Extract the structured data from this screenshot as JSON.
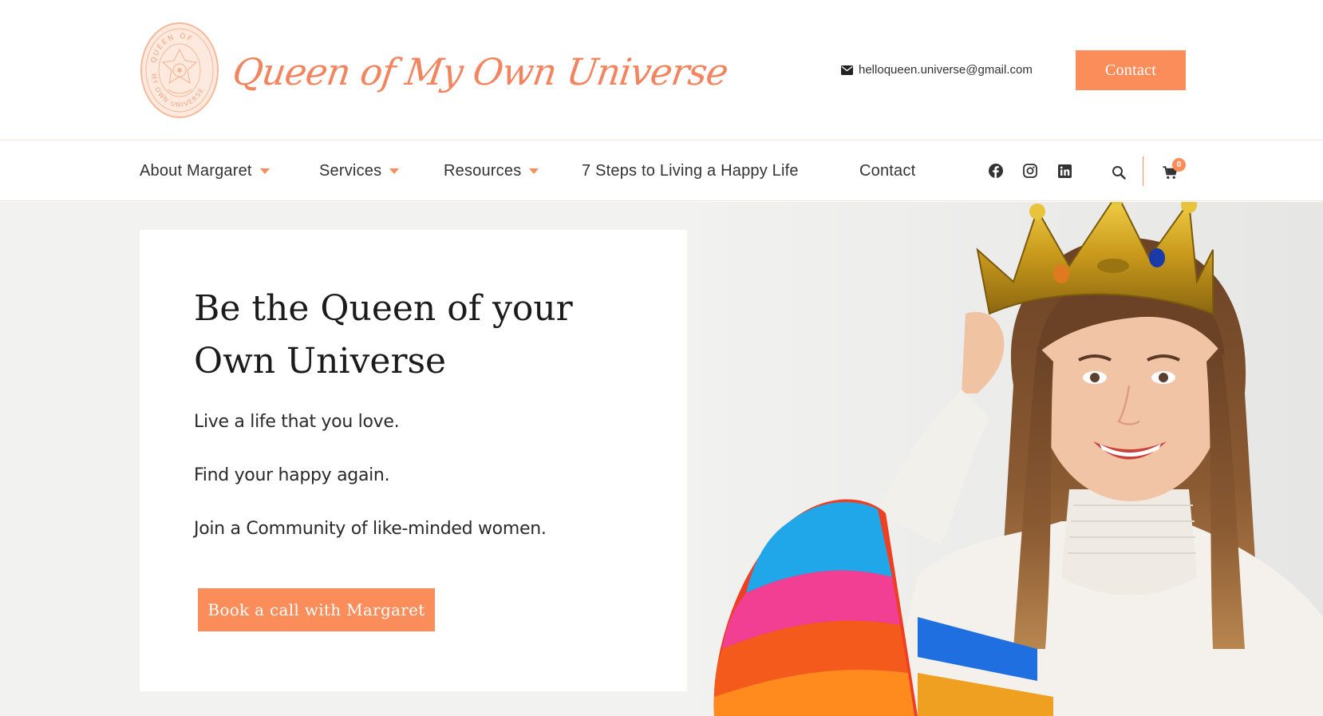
{
  "header": {
    "brand": "Queen of My Own Universe",
    "seal_text": "QUEEN OF MY OWN UNIVERSE",
    "email": "helloqueen.universe@gmail.com",
    "contact_label": "Contact",
    "email_icon": "envelope-icon"
  },
  "nav": {
    "items": [
      {
        "label": "About Margaret",
        "dropdown": true
      },
      {
        "label": "Services",
        "dropdown": true
      },
      {
        "label": "Resources",
        "dropdown": true
      },
      {
        "label": "7 Steps to Living a Happy Life",
        "dropdown": false
      },
      {
        "label": "Contact",
        "dropdown": false
      }
    ],
    "social_icons": [
      "facebook-icon",
      "instagram-icon",
      "linkedin-icon"
    ],
    "search_icon": "search-icon",
    "cart_icon": "cart-icon",
    "cart_count": "0"
  },
  "hero": {
    "headline_line1": "Be the Queen of your",
    "headline_line2": "Own Universe",
    "paragraphs": [
      "Live a life that you love.",
      "Find your happy again.",
      "Join a Community of like-minded women."
    ],
    "cta_label": "Book a call with Margaret",
    "image_alt": "Smiling woman wearing a gold crown and colourful knit sweater"
  },
  "colors": {
    "accent": "#fb8d5b",
    "brand_text": "#f28560",
    "hero_background": "#f2f2f1",
    "text": "#222222"
  }
}
